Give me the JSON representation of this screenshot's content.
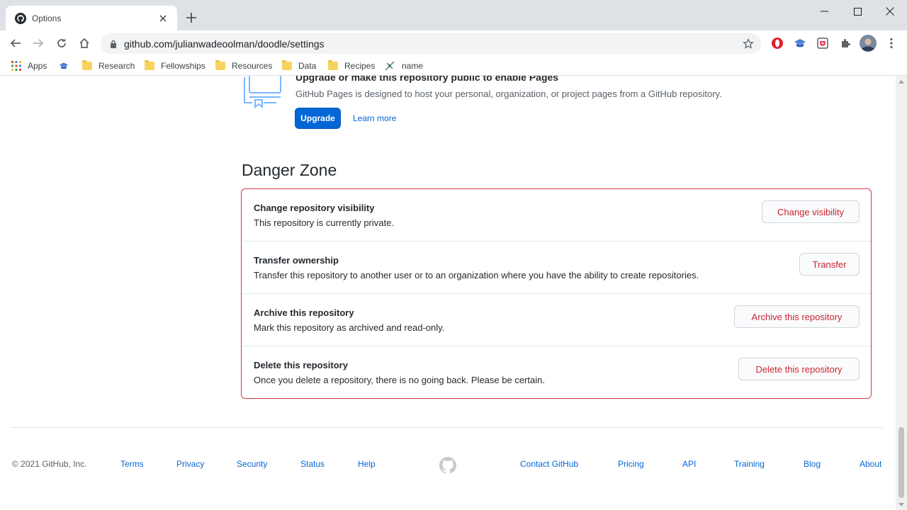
{
  "browser": {
    "tab_title": "Options",
    "url": "github.com/julianwadeoolman/doodle/settings",
    "bookmarks": {
      "apps": "Apps",
      "research": "Research",
      "fellowships": "Fellowships",
      "resources": "Resources",
      "data": "Data",
      "recipes": "Recipes",
      "name": "name"
    }
  },
  "pages": {
    "heading": "Upgrade or make this repository public to enable Pages",
    "description": "GitHub Pages is designed to host your personal, organization, or project pages from a GitHub repository.",
    "upgrade_label": "Upgrade",
    "learn_more_label": "Learn more"
  },
  "danger_zone": {
    "title": "Danger Zone",
    "rows": [
      {
        "title": "Change repository visibility",
        "description": "This repository is currently private.",
        "button": "Change visibility"
      },
      {
        "title": "Transfer ownership",
        "description": "Transfer this repository to another user or to an organization where you have the ability to create repositories.",
        "button": "Transfer"
      },
      {
        "title": "Archive this repository",
        "description": "Mark this repository as archived and read-only.",
        "button": "Archive this repository"
      },
      {
        "title": "Delete this repository",
        "description": "Once you delete a repository, there is no going back. Please be certain.",
        "button": "Delete this repository"
      }
    ]
  },
  "footer": {
    "copyright": "© 2021 GitHub, Inc.",
    "left_links": [
      "Terms",
      "Privacy",
      "Security",
      "Status",
      "Help"
    ],
    "right_links": [
      "Contact GitHub",
      "Pricing",
      "API",
      "Training",
      "Blog",
      "About"
    ]
  },
  "colors": {
    "danger": "#d73a49",
    "link": "#0366d6",
    "primary_button": "#0366d6"
  }
}
